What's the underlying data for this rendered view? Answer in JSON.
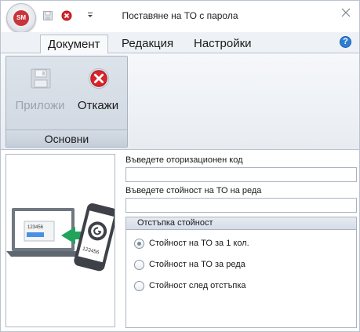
{
  "window": {
    "title": "Поставяне на ТО с парола",
    "app_logo_text": "SM"
  },
  "qat": {
    "icons": [
      "save-icon",
      "cancel-icon",
      "customize-dropdown-icon"
    ]
  },
  "tabs": [
    {
      "label": "Документ",
      "active": true
    },
    {
      "label": "Редакция",
      "active": false
    },
    {
      "label": "Настройки",
      "active": false
    }
  ],
  "help": {
    "glyph": "?"
  },
  "ribbon": {
    "group_label": "Основни",
    "apply_label": "Приложи",
    "cancel_label": "Откажи"
  },
  "form": {
    "auth_code_label": "Въведете оторизационен код",
    "auth_code_value": "",
    "row_value_label": "Въведете стойност на ТО на реда",
    "row_value_value": "",
    "discount_group_label": "Отстъпка стойност",
    "options": [
      {
        "label": "Стойност на ТО за 1 кол.",
        "checked": true
      },
      {
        "label": "Стойност на ТО за реда",
        "checked": false
      },
      {
        "label": "Стойност след отстъпка",
        "checked": false
      }
    ]
  },
  "illustration": {
    "laptop_screen_text": "123456",
    "phone_screen_text": "123456"
  },
  "colors": {
    "accent_blue": "#2e7dd6",
    "cancel_red": "#d9242b",
    "arrow_green": "#21a35a"
  }
}
